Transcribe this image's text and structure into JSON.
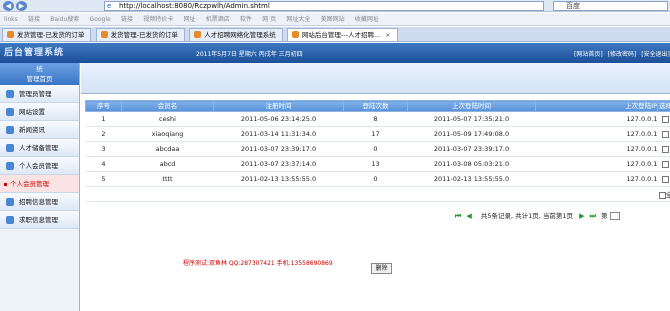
{
  "browser": {
    "url": "http://localhost:8080/Rczpwlh/Admin.shtml",
    "search_placeholder": "百度"
  },
  "favorites": [
    "links",
    "链接",
    "Baidu搜索",
    "Google",
    "链接",
    "视频特价卡",
    "网址",
    "机票酒店",
    "软件",
    "网 页",
    "网址大全",
    "美图网站",
    "收藏网址"
  ],
  "tabs": [
    {
      "label": "发货管理-已发货的订单",
      "active": false
    },
    {
      "label": "发货管理-已发货的订单",
      "active": false
    },
    {
      "label": "人才招聘网络化管理系统",
      "active": false
    },
    {
      "label": "网站后台管理---人才招聘...",
      "active": true
    }
  ],
  "header": {
    "logo": "后台管理系统",
    "date_text": "2011年5月7日 星期六 丙戌年 三月初四",
    "links": [
      "[网站首页]",
      "[修改密码]",
      "[安全退出]"
    ]
  },
  "sidebar": {
    "title": "统",
    "subtitle": "管理首页",
    "items": [
      {
        "label": "管理员管理",
        "sub": false
      },
      {
        "label": "网站设置",
        "sub": false
      },
      {
        "label": "新闻资讯",
        "sub": false
      },
      {
        "label": "人才储备管理",
        "sub": false
      },
      {
        "label": "个人会员管理",
        "sub": false
      },
      {
        "label": "个人会员管理",
        "sub": true
      },
      {
        "label": "招聘信息管理",
        "sub": false
      },
      {
        "label": "求职信息管理",
        "sub": false
      }
    ]
  },
  "table": {
    "columns": [
      "序号",
      "会员名",
      "注册时间",
      "登陆次数",
      "上次登陆时间",
      "上次登陆IP",
      "选择"
    ],
    "rows": [
      [
        "1",
        "ceshi",
        "2011-05-06 23:14:25.0",
        "8",
        "2011-05-07 17:35:21.0",
        "127.0.0.1"
      ],
      [
        "2",
        "xiaoqiang",
        "2011-03-14 11:31:34.0",
        "17",
        "2011-05-09 17:49:08.0",
        "127.0.0.1"
      ],
      [
        "3",
        "abcdaa",
        "2011-03-07 23:39:17.0",
        "0",
        "2011-03-07 23:39:17.0",
        "127.0.0.1"
      ],
      [
        "4",
        "abcd",
        "2011-03-07 23:37:14.0",
        "13",
        "2011-03-08 05:03:21.0",
        "127.0.0.1"
      ],
      [
        "5",
        "tttt",
        "2011-02-13 13:55:55.0",
        "0",
        "2011-02-13 13:55:55.0",
        "127.0.0.1"
      ]
    ],
    "select_all": "全"
  },
  "pager": {
    "summary": "共5条记录, 共计1页, 当前第1页",
    "goto_prefix": "第",
    "first": "⏮",
    "prev": "◀",
    "next": "▶",
    "last": "⏭"
  },
  "actions": {
    "delete_label": "删除"
  },
  "footer": {
    "text": "程序测试:双鱼林  QQ:287307421  手机:13558690869"
  }
}
